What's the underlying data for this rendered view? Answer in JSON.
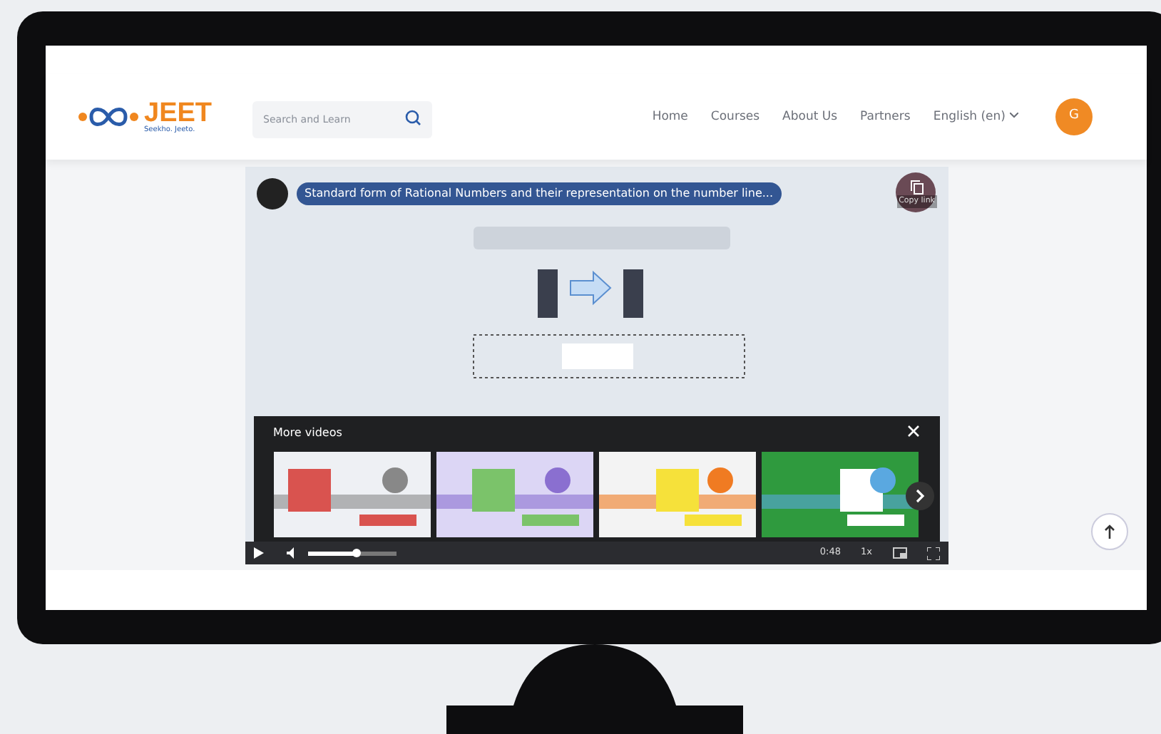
{
  "header": {
    "logo": {
      "name": "JEET",
      "tagline": "Seekho. Jeeto."
    },
    "search": {
      "placeholder": "Search and Learn"
    },
    "nav": [
      {
        "label": "Home",
        "dropdown": false
      },
      {
        "label": "Courses",
        "dropdown": false
      },
      {
        "label": "About Us",
        "dropdown": false
      },
      {
        "label": "Partners",
        "dropdown": false
      },
      {
        "label": "English (en)",
        "dropdown": true
      }
    ],
    "avatar": "G"
  },
  "video": {
    "title": "Standard form of Rational Numbers and their representation on the number line...",
    "copy_label": "Copy link",
    "more_videos": {
      "heading": "More videos"
    },
    "controls": {
      "volume": {
        "level": 0.55
      },
      "time": "0:48",
      "speed": "1x"
    }
  }
}
